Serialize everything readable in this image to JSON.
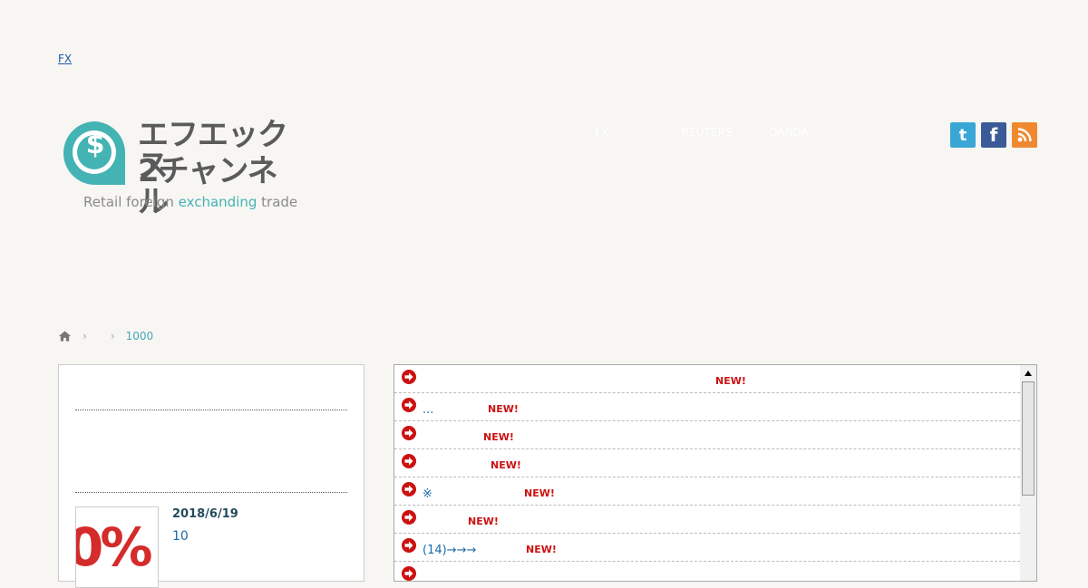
{
  "top_link": "FX",
  "logo": {
    "line1": "エフエックス",
    "line2": "2チャンネル",
    "tagline_pre": "Retail foreign ",
    "tagline_accent": "exchanding",
    "tagline_post": " trade",
    "brand_color": "#44b3b4",
    "symbol": "$"
  },
  "nav": [
    "FX",
    "REUTERS",
    "OANDA"
  ],
  "social": {
    "twitter": "t",
    "facebook": "f"
  },
  "breadcrumb": {
    "current": "1000"
  },
  "sidebar": {
    "post_date": "2018/6/19",
    "post_count": "10",
    "thumb_text": "0%"
  },
  "feed": {
    "new_label": "NEW!",
    "items": [
      {
        "text": ""
      },
      {
        "text": "..."
      },
      {
        "text": ""
      },
      {
        "text": ""
      },
      {
        "text": "※"
      },
      {
        "text": ""
      },
      {
        "text": "(14)→→→"
      },
      {
        "text": ""
      }
    ]
  }
}
